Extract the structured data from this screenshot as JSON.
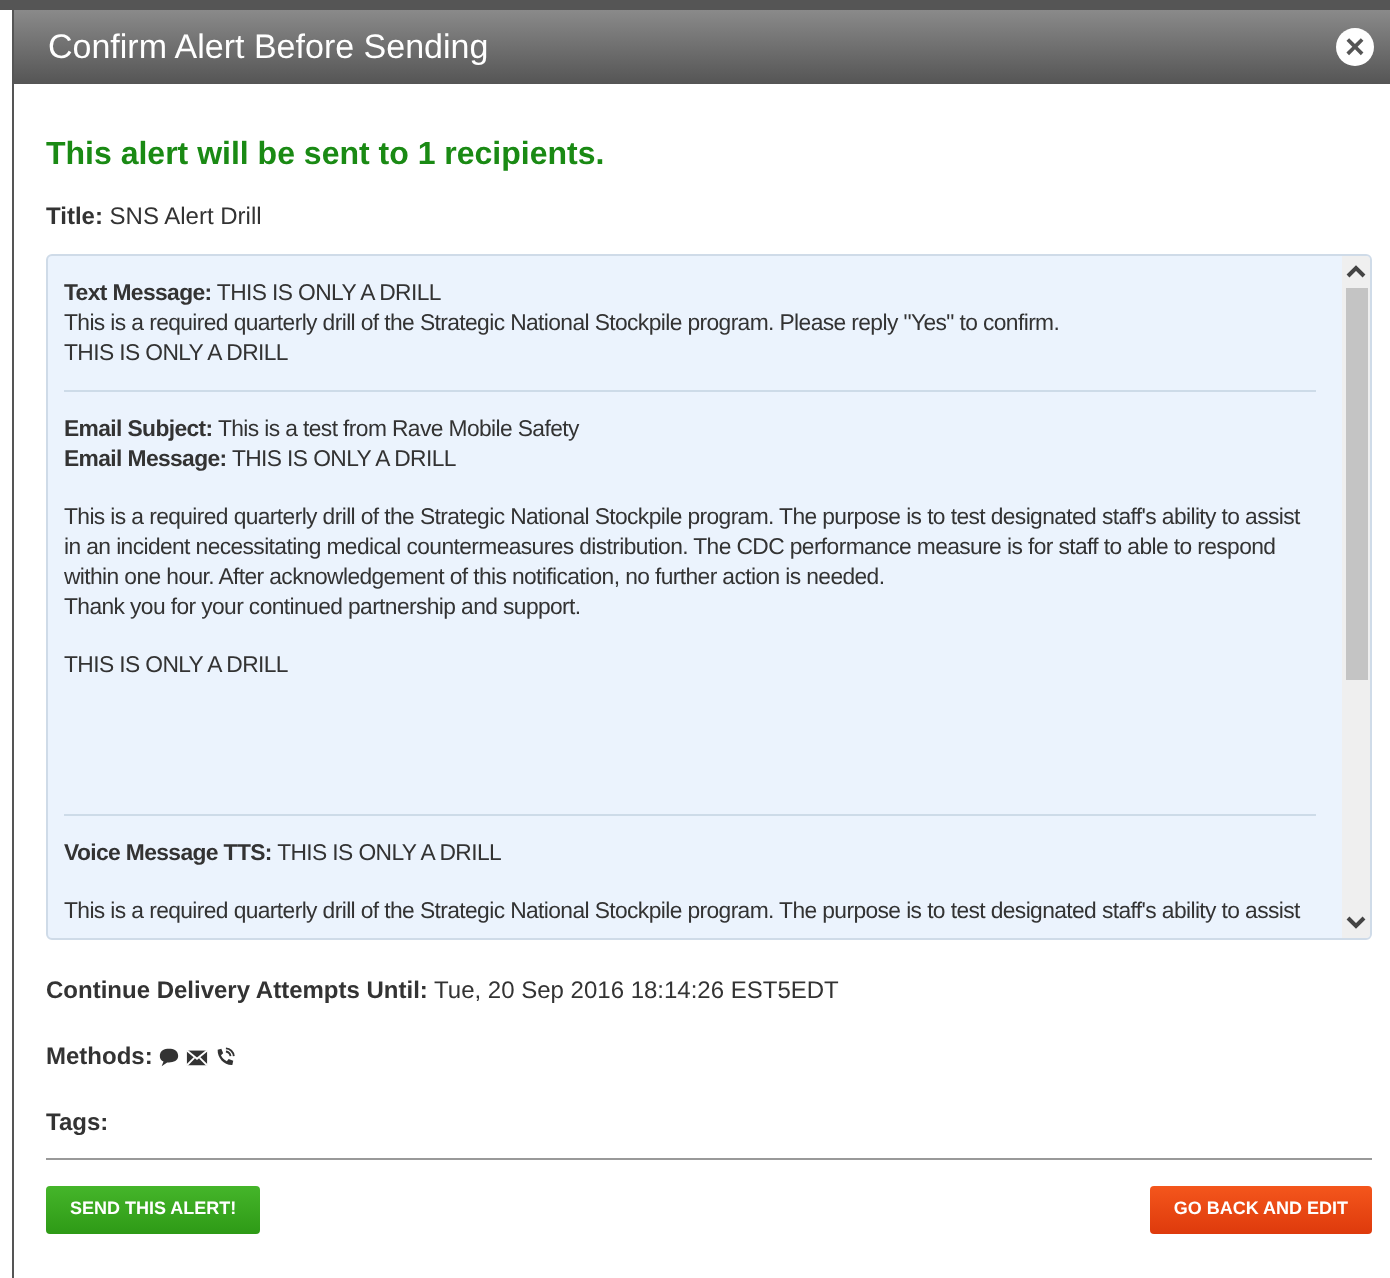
{
  "dialog": {
    "title": "Confirm Alert Before Sending",
    "close": "×"
  },
  "headline": "This alert will be sent to 1 recipients.",
  "title_field": {
    "label": "Title:",
    "value": "SNS Alert Drill"
  },
  "messages": [
    {
      "paragraphs": [
        [
          {
            "label": "Text Message:",
            "value": "THIS IS ONLY A DRILL"
          },
          {
            "text": "This is a required quarterly drill of the Strategic National Stockpile program. Please reply \"Yes\" to confirm."
          },
          {
            "text": "THIS IS ONLY A DRILL"
          }
        ]
      ]
    },
    {
      "paragraphs": [
        [
          {
            "label": "Email Subject:",
            "value": "This is a test from Rave Mobile Safety"
          },
          {
            "label": "Email Message:",
            "value": "THIS IS ONLY A DRILL"
          }
        ],
        [
          {
            "text": "This is a required quarterly drill of the Strategic National Stockpile program. The purpose is to test designated staff's ability to assist in an incident necessitating medical countermeasures distribution. The CDC performance measure is for staff to able to respond within one hour. After acknowledgement of this notification, no further action is needed."
          },
          {
            "text": "Thank you for your continued partnership and support."
          }
        ],
        [
          {
            "text": "THIS IS ONLY A DRILL"
          }
        ]
      ]
    },
    {
      "paragraphs": [
        [
          {
            "label": "Voice Message TTS:",
            "value": "THIS IS ONLY A DRILL"
          }
        ],
        [
          {
            "text": "This is a required quarterly drill of the Strategic National Stockpile program. The purpose is to test designated staff's ability to assist"
          }
        ]
      ]
    }
  ],
  "delivery": {
    "label": "Continue Delivery Attempts Until:",
    "value": "Tue, 20 Sep 2016 18:14:26 EST5EDT"
  },
  "methods": {
    "label": "Methods:",
    "items": [
      {
        "kind": "sms"
      },
      {
        "kind": "email"
      },
      {
        "kind": "voice"
      }
    ]
  },
  "tags": {
    "label": "Tags:"
  },
  "buttons": [
    {
      "label": "SEND THIS ALERT!",
      "kind": "primary"
    },
    {
      "label": "GO BACK AND EDIT",
      "kind": "danger"
    }
  ]
}
